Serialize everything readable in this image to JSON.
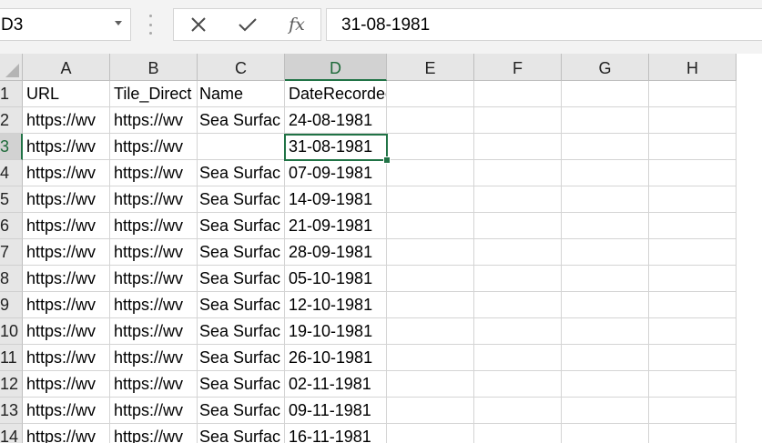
{
  "name_box": {
    "value": "D3"
  },
  "formula_bar": {
    "cancel_icon": "close-icon",
    "enter_icon": "check-icon",
    "function_label": "fx",
    "value": "31-08-1981"
  },
  "accent_color": "#217346",
  "columns": [
    "A",
    "B",
    "C",
    "D",
    "E",
    "F",
    "G",
    "H"
  ],
  "rows": [
    {
      "num": "1",
      "a": "URL",
      "b": "Tile_Direct",
      "c": "Name",
      "d": "DateRecorded"
    },
    {
      "num": "2",
      "a": "https://wv",
      "b": "https://wv",
      "c": "Sea Surfac",
      "d": "24-08-1981"
    },
    {
      "num": "3",
      "a": "https://wv",
      "b": "https://wv",
      "c": "",
      "d": "31-08-1981"
    },
    {
      "num": "4",
      "a": "https://wv",
      "b": "https://wv",
      "c": "Sea Surfac",
      "d": "07-09-1981"
    },
    {
      "num": "5",
      "a": "https://wv",
      "b": "https://wv",
      "c": "Sea Surfac",
      "d": "14-09-1981"
    },
    {
      "num": "6",
      "a": "https://wv",
      "b": "https://wv",
      "c": "Sea Surfac",
      "d": "21-09-1981"
    },
    {
      "num": "7",
      "a": "https://wv",
      "b": "https://wv",
      "c": "Sea Surfac",
      "d": "28-09-1981"
    },
    {
      "num": "8",
      "a": "https://wv",
      "b": "https://wv",
      "c": "Sea Surfac",
      "d": "05-10-1981"
    },
    {
      "num": "9",
      "a": "https://wv",
      "b": "https://wv",
      "c": "Sea Surfac",
      "d": "12-10-1981"
    },
    {
      "num": "10",
      "a": "https://wv",
      "b": "https://wv",
      "c": "Sea Surfac",
      "d": "19-10-1981"
    },
    {
      "num": "11",
      "a": "https://wv",
      "b": "https://wv",
      "c": "Sea Surfac",
      "d": "26-10-1981"
    },
    {
      "num": "12",
      "a": "https://wv",
      "b": "https://wv",
      "c": "Sea Surfac",
      "d": "02-11-1981"
    },
    {
      "num": "13",
      "a": "https://wv",
      "b": "https://wv",
      "c": "Sea Surfac",
      "d": "09-11-1981"
    },
    {
      "num": "14",
      "a": "https://wv",
      "b": "https://wv",
      "c": "Sea Surfac",
      "d": "16-11-1981"
    }
  ]
}
